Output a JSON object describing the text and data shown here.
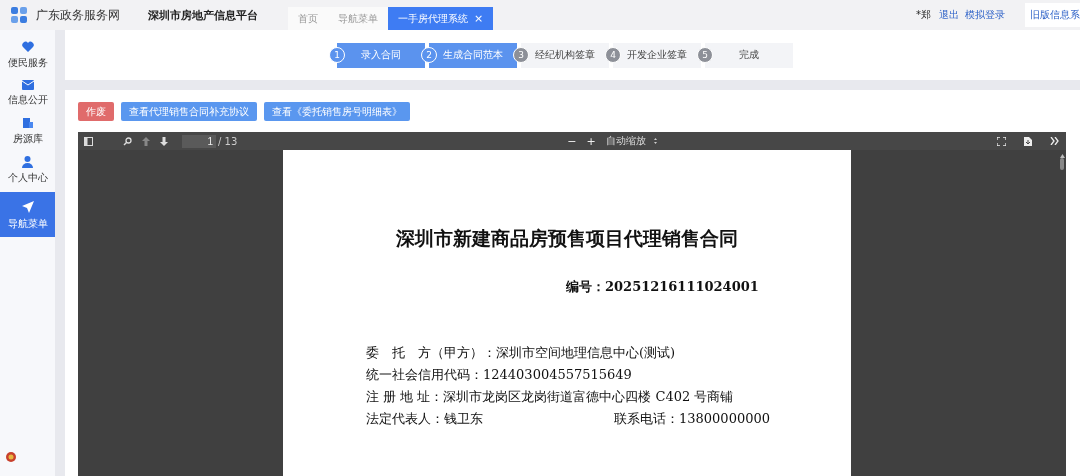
{
  "header": {
    "site_name": "广东政务服务网",
    "platform_name": "深圳市房地产信息平台",
    "tabs": [
      {
        "label": "首页",
        "selected": false,
        "closable": false
      },
      {
        "label": "导航菜单",
        "selected": false,
        "closable": false
      },
      {
        "label": "一手房代理系统",
        "selected": true,
        "closable": true
      }
    ],
    "close_glyph": "×",
    "user": "*郑",
    "links": [
      "退出",
      "模拟登录"
    ],
    "old_system": "旧版信息系"
  },
  "sidebar": {
    "items": [
      {
        "label": "便民服务",
        "selected": false
      },
      {
        "label": "信息公开",
        "selected": false
      },
      {
        "label": "房源库",
        "selected": false
      },
      {
        "label": "个人中心",
        "selected": false
      },
      {
        "label": "导航菜单",
        "selected": true
      }
    ]
  },
  "steps": [
    {
      "number": "1",
      "label": "录入合同",
      "done": true
    },
    {
      "number": "2",
      "label": "生成合同范本",
      "done": true
    },
    {
      "number": "3",
      "label": "经纪机构签章",
      "done": false
    },
    {
      "number": "4",
      "label": "开发企业签章",
      "done": false
    },
    {
      "number": "5",
      "label": "完成",
      "done": false
    }
  ],
  "actions": [
    {
      "label": "作废",
      "kind": "danger"
    },
    {
      "label": "查看代理销售合同补充协议",
      "kind": "primary"
    },
    {
      "label": "查看《委托销售房号明细表》",
      "kind": "primary"
    }
  ],
  "viewer": {
    "page_input": "1",
    "page_count": "/ 13",
    "zoom_out": "−",
    "zoom_in": "+",
    "zoom": "自动缩放"
  },
  "document": {
    "title": "深圳市新建商品房预售项目代理销售合同",
    "number": "编号：20251216111024001",
    "lines": [
      {
        "text": "委　托　方（甲方）：深圳市空间地理信息中心(测试)"
      },
      {
        "text": "统一社会信用代码：124403004557515649"
      },
      {
        "text": "注 册 地 址：深圳市龙岗区龙岗街道富德中心四楼 C402 号商铺"
      },
      {
        "text": "法定代表人：钱卫东",
        "right": "联系电话：13800000000"
      }
    ]
  }
}
